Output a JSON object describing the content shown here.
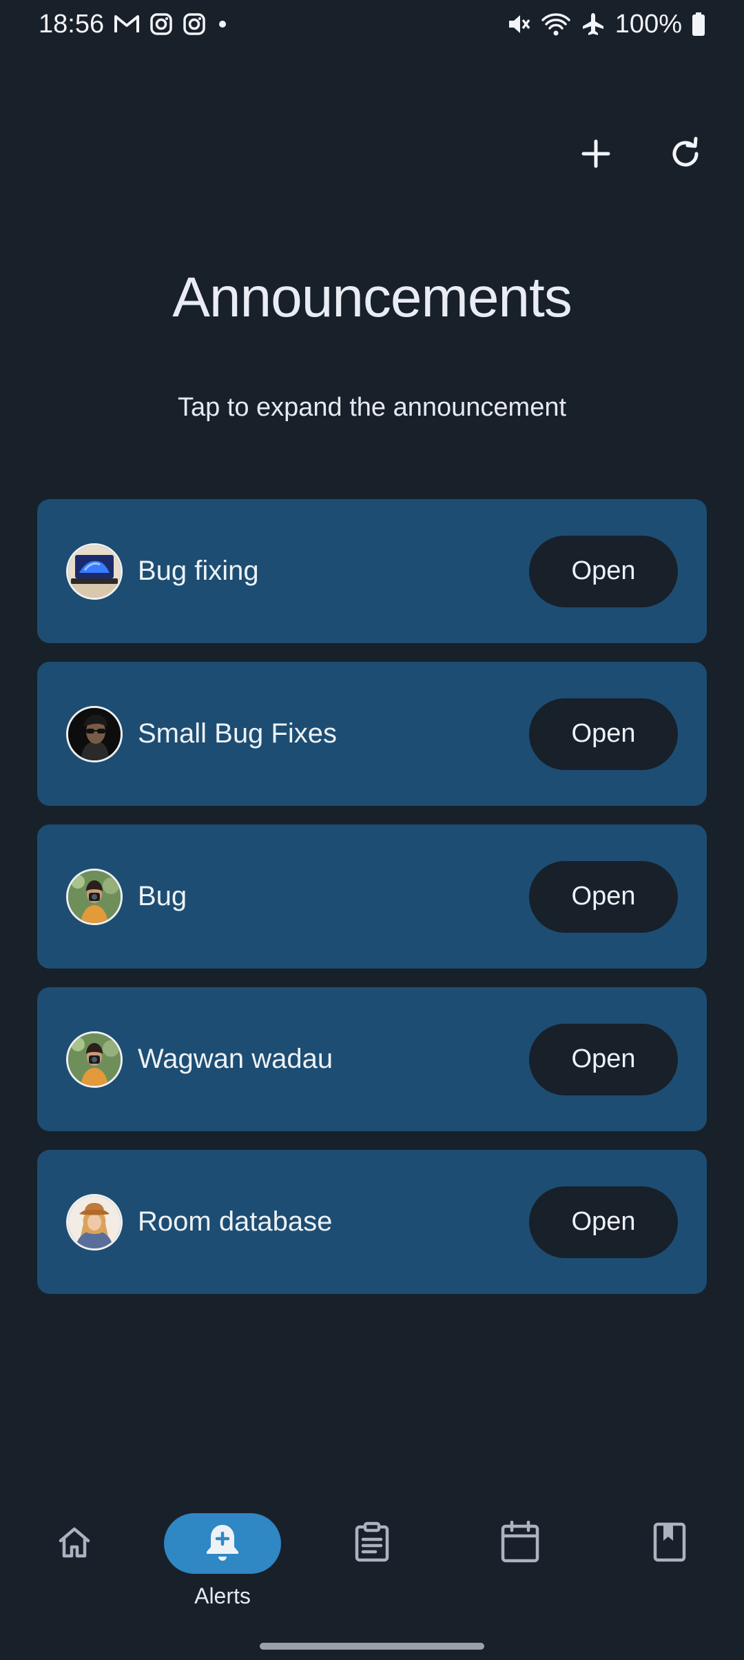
{
  "status_bar": {
    "time": "18:56",
    "notification_icons": [
      "gmail-icon",
      "instagram-icon",
      "instagram-icon",
      "dot-icon"
    ],
    "system_icons": [
      "mute-icon",
      "wifi-icon",
      "airplane-icon"
    ],
    "battery": "100%"
  },
  "toolbar": {
    "add_icon": "plus-icon",
    "refresh_icon": "refresh-icon"
  },
  "header": {
    "title": "Announcements",
    "subtitle": "Tap to expand the announcement"
  },
  "announcements": [
    {
      "title": "Bug fixing",
      "button": "Open",
      "avatar": "laptop-photo"
    },
    {
      "title": "Small Bug Fixes",
      "button": "Open",
      "avatar": "sunglasses-portrait"
    },
    {
      "title": "Bug",
      "button": "Open",
      "avatar": "photographer-portrait"
    },
    {
      "title": "Wagwan wadau",
      "button": "Open",
      "avatar": "photographer-portrait"
    },
    {
      "title": "Room database",
      "button": "Open",
      "avatar": "woman-hat-portrait"
    }
  ],
  "bottom_nav": {
    "items": [
      {
        "icon": "home-icon",
        "label": ""
      },
      {
        "icon": "bell-plus-icon",
        "label": "Alerts",
        "active": true
      },
      {
        "icon": "clipboard-icon",
        "label": ""
      },
      {
        "icon": "calendar-icon",
        "label": ""
      },
      {
        "icon": "bookmark-book-icon",
        "label": ""
      }
    ]
  },
  "colors": {
    "background": "#18202a",
    "card": "#1d4d72",
    "active_pill": "#2f87c4",
    "text": "#e6eaf0"
  }
}
